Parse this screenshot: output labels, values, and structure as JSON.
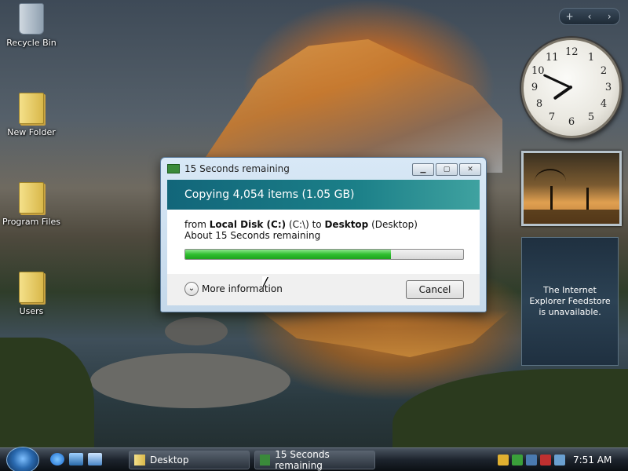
{
  "desktop": {
    "icons": [
      {
        "label": "Recycle Bin"
      },
      {
        "label": "New Folder"
      },
      {
        "label": "Program Files"
      },
      {
        "label": "Users"
      }
    ]
  },
  "sidebar": {
    "toolbar": {
      "add": "+",
      "prev": "‹",
      "next": "›"
    },
    "clock_numbers": [
      "12",
      "1",
      "2",
      "3",
      "4",
      "5",
      "6",
      "7",
      "8",
      "9",
      "10",
      "11"
    ],
    "feed_message": "The Internet Explorer Feedstore is unavailable."
  },
  "dialog": {
    "title": "15 Seconds remaining",
    "heading": "Copying 4,054 items (1.05 GB)",
    "from_prefix": "from",
    "source_bold": "Local Disk (C:)",
    "source_path": "(C:\\)",
    "to_word": "to",
    "dest_bold": "Desktop",
    "dest_paren": "(Desktop)",
    "time_remaining": "About 15 Seconds remaining",
    "progress_fraction": 0.74,
    "more_info": "More information",
    "cancel": "Cancel",
    "buttons": {
      "minimize": "▁",
      "restore": "▢",
      "close": "✕"
    }
  },
  "taskbar": {
    "tasks": [
      {
        "label": "Desktop"
      },
      {
        "label": "15 Seconds remaining"
      }
    ],
    "time": "7:51 AM"
  }
}
